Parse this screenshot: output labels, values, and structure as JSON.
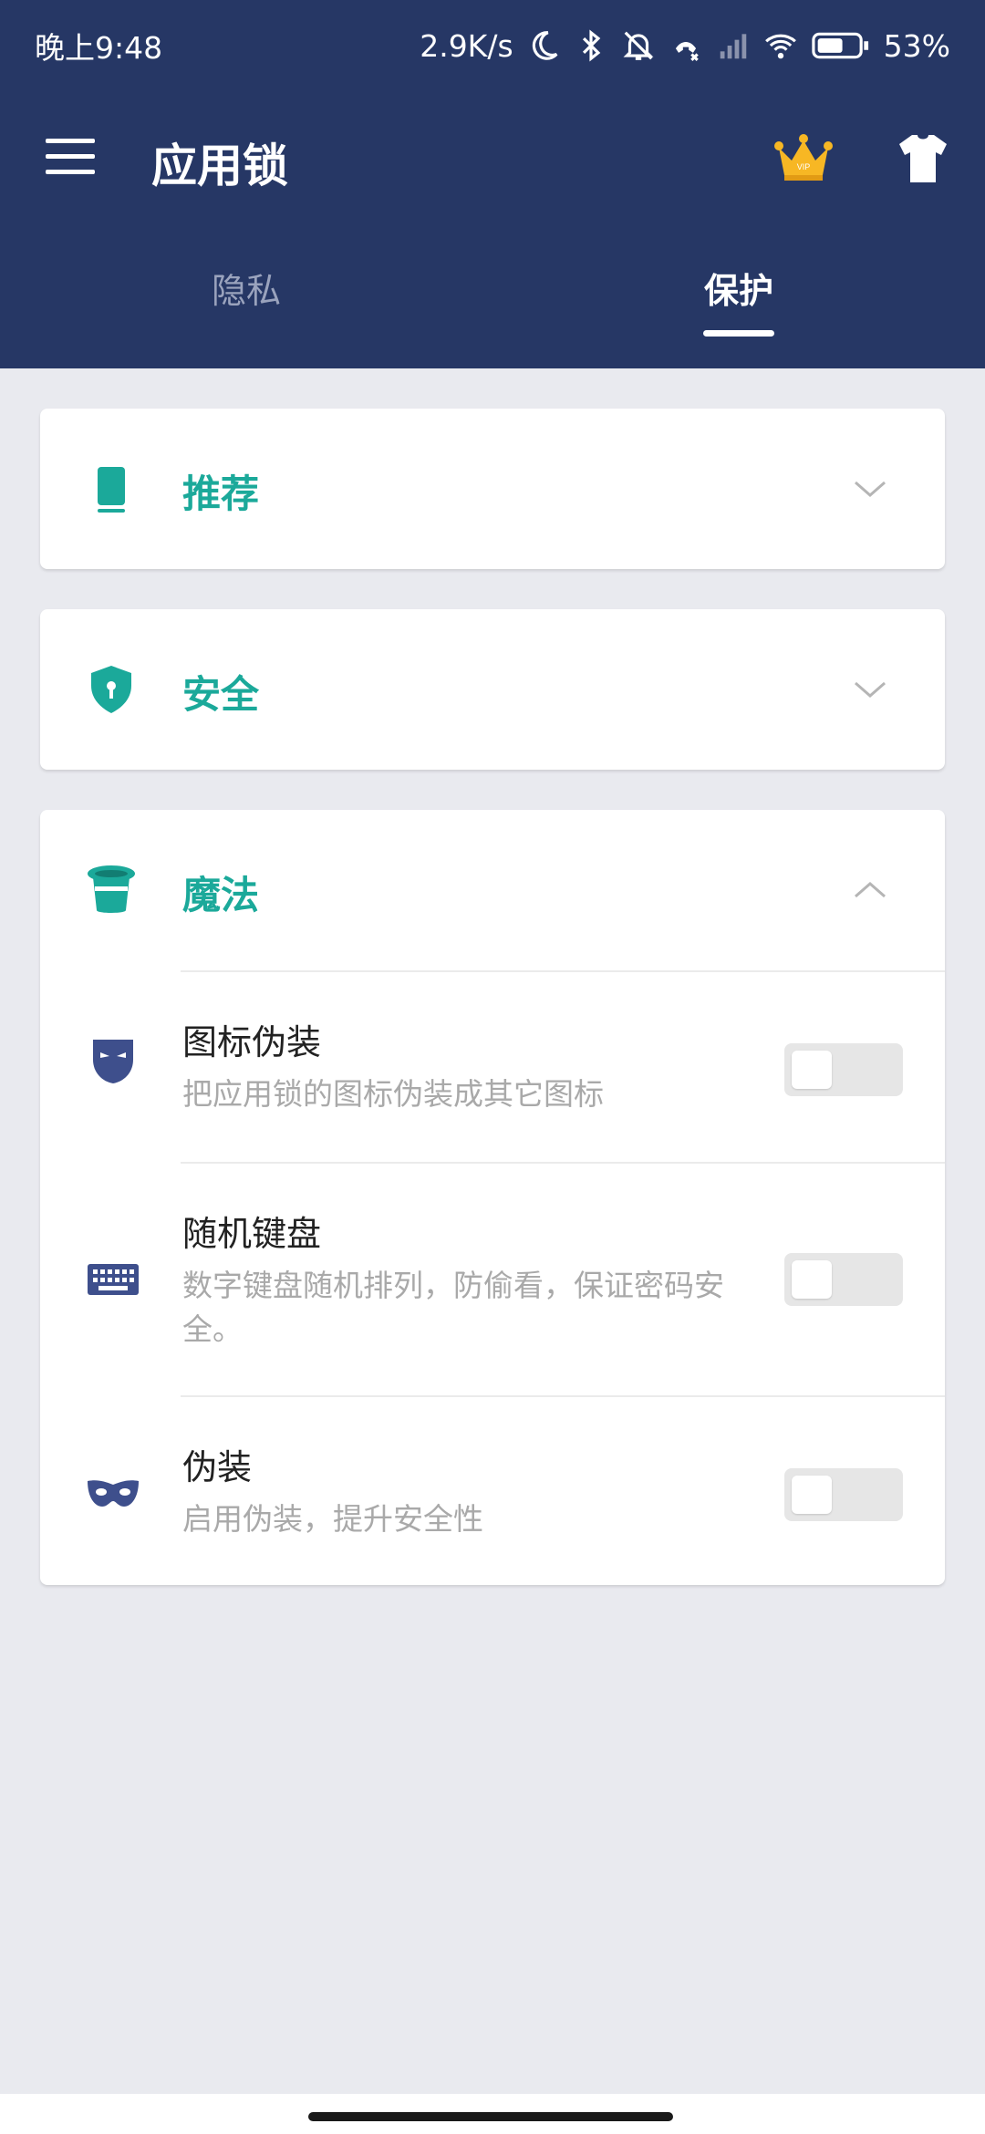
{
  "status_bar": {
    "time": "晚上9:48",
    "network_speed": "2.9K/s",
    "battery": "53%",
    "icons": [
      "moon-icon",
      "bluetooth-icon",
      "bell-muted-icon",
      "call-icon",
      "signal-icon",
      "wifi-icon",
      "battery-icon"
    ]
  },
  "toolbar": {
    "title": "应用锁",
    "icons": [
      "menu-icon",
      "vip-crown-icon",
      "tshirt-icon"
    ]
  },
  "tabs": [
    {
      "label": "隐私",
      "active": false
    },
    {
      "label": "保护",
      "active": true
    }
  ],
  "sections": [
    {
      "title": "推荐",
      "icon": "phone-icon",
      "expanded": false
    },
    {
      "title": "安全",
      "icon": "shield-icon",
      "expanded": false
    },
    {
      "title": "魔法",
      "icon": "magic-hat-icon",
      "expanded": true,
      "items": [
        {
          "title": "图标伪装",
          "desc": "把应用锁的图标伪装成其它图标",
          "icon": "face-mask-icon",
          "enabled": false
        },
        {
          "title": "随机键盘",
          "desc": "数字键盘随机排列，防偷看，保证密码安全。",
          "icon": "keyboard-icon",
          "enabled": false
        },
        {
          "title": "伪装",
          "desc": "启用伪装，提升安全性",
          "icon": "eye-mask-icon",
          "enabled": false
        }
      ]
    }
  ],
  "colors": {
    "header": "#263765",
    "accent": "#1ba99a",
    "icon_blue": "#3e4f8c",
    "background": "#e9eaef"
  }
}
